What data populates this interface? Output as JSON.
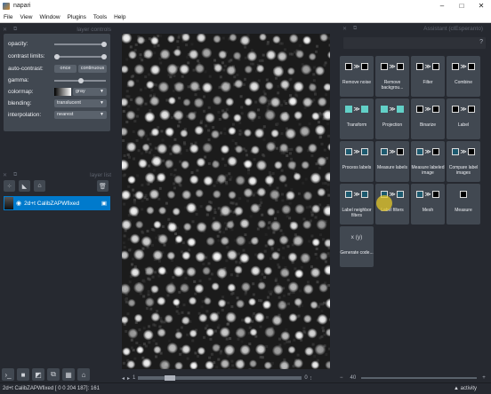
{
  "window": {
    "title": "napari",
    "controls": [
      "–",
      "□",
      "✕"
    ]
  },
  "menu": [
    "File",
    "View",
    "Window",
    "Plugins",
    "Tools",
    "Help"
  ],
  "layer_controls": {
    "header": "layer controls",
    "opacity_label": "opacity:",
    "contrast_label": "contrast limits:",
    "autocontrast_label": "auto-contrast:",
    "once_label": "once",
    "continuous_label": "continuous",
    "gamma_label": "gamma:",
    "colormap_label": "colormap:",
    "colormap_value": "gray",
    "blending_label": "blending:",
    "blending_value": "translucent",
    "interpolation_label": "interpolation:",
    "interpolation_value": "nearest",
    "opacity_level": 1.0,
    "gamma_level": 0.5
  },
  "layer_list": {
    "header": "layer list",
    "layer_name": "2d+t CalibZAPWfixed"
  },
  "assistant": {
    "header": "Assistant (clEsperanto)",
    "tiles": [
      {
        "label": "Remove noise",
        "icons": [
          "sq",
          "ar",
          "sq"
        ]
      },
      {
        "label": "Remove backgrou...",
        "icons": [
          "sq",
          "ar",
          "sq"
        ]
      },
      {
        "label": "Filter",
        "icons": [
          "sq",
          "ar",
          "sq"
        ]
      },
      {
        "label": "Combine",
        "icons": [
          "sq",
          "ar",
          "sq"
        ]
      },
      {
        "label": "Transform",
        "icons": [
          "g",
          "ar",
          "g"
        ]
      },
      {
        "label": "Projection",
        "icons": [
          "g",
          "ar",
          "g"
        ]
      },
      {
        "label": "Binarize",
        "icons": [
          "sq",
          "ar",
          "sq"
        ]
      },
      {
        "label": "Label",
        "icons": [
          "sq",
          "ar",
          "sq"
        ]
      },
      {
        "label": "Process labels",
        "icons": [
          "c",
          "ar",
          "c"
        ]
      },
      {
        "label": "Measure labels",
        "icons": [
          "c",
          "ar",
          "sq"
        ]
      },
      {
        "label": "Measure labeled image",
        "icons": [
          "c",
          "ar",
          "sq"
        ]
      },
      {
        "label": "Compare label images",
        "icons": [
          "c",
          "ar",
          "sq"
        ]
      },
      {
        "label": "Label neighbor filters",
        "icons": [
          "c",
          "ar",
          "c"
        ]
      },
      {
        "label": "Label filters",
        "icons": [
          "c",
          "ar",
          "c"
        ]
      },
      {
        "label": "Mesh",
        "icons": [
          "c",
          "ar",
          "sq"
        ]
      },
      {
        "label": "Measure",
        "icons": [
          "sq"
        ]
      },
      {
        "label": "Generate code...",
        "icons": [
          "x(y)"
        ]
      }
    ]
  },
  "dims": {
    "current": "1",
    "end": "0"
  },
  "zoom": {
    "minus": "−",
    "value": "40",
    "plus": "+"
  },
  "status": {
    "text": "2d+t CalibZAPWfixed [ 0 0 204 187]: 161",
    "activity": "▲ activity"
  },
  "colors": {
    "accent": "#007acc",
    "panel": "#414851",
    "background": "#262930"
  }
}
